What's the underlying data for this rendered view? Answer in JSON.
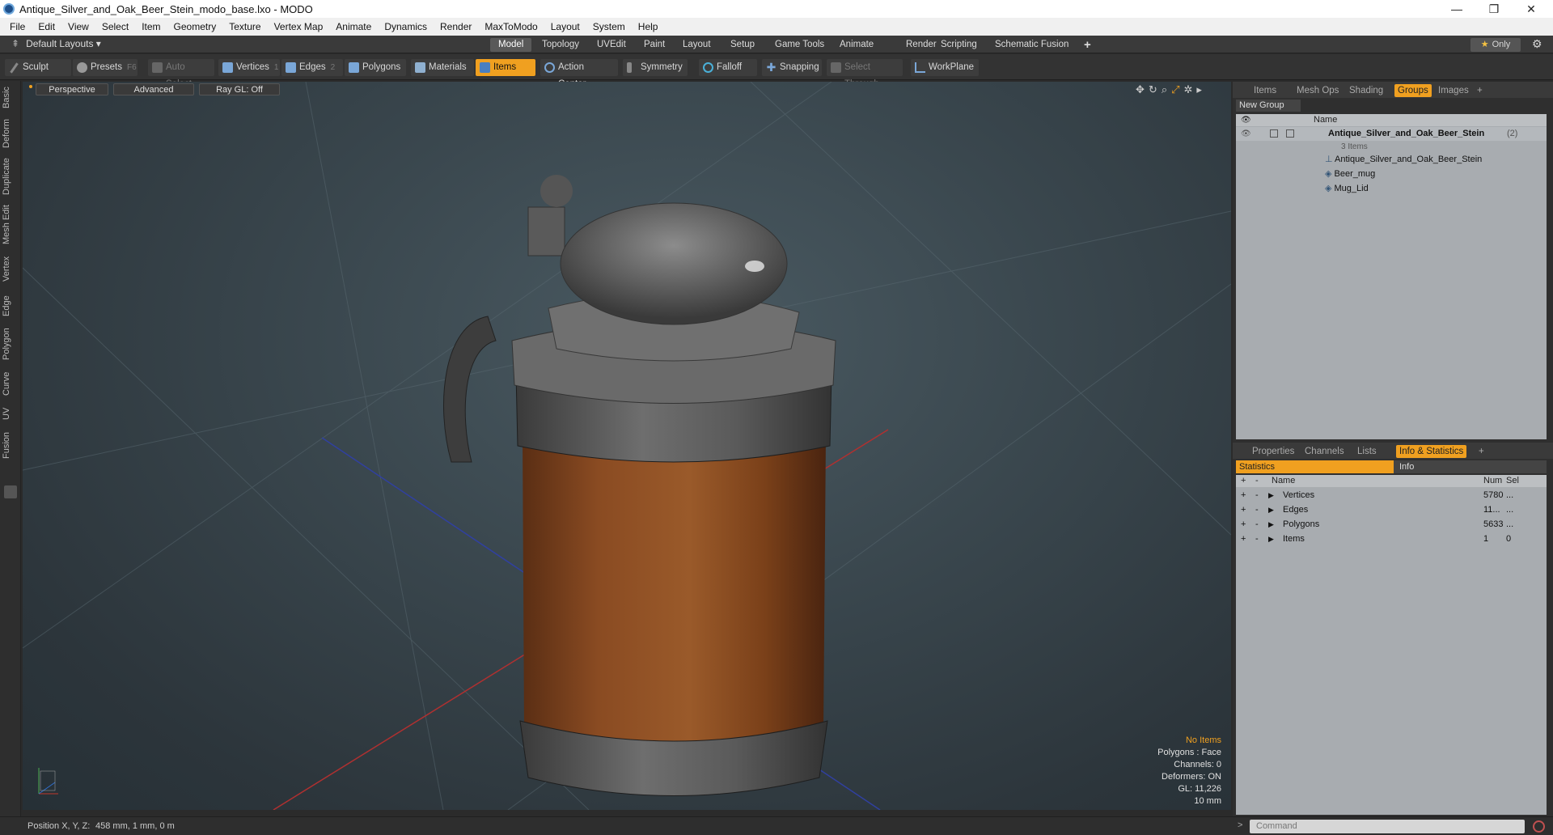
{
  "window": {
    "title": "Antique_Silver_and_Oak_Beer_Stein_modo_base.lxo - MODO",
    "minimize": "—",
    "maximize": "❐",
    "close": "✕"
  },
  "menu": [
    "File",
    "Edit",
    "View",
    "Select",
    "Item",
    "Geometry",
    "Texture",
    "Vertex Map",
    "Animate",
    "Dynamics",
    "Render",
    "MaxToModo",
    "Layout",
    "System",
    "Help"
  ],
  "layoutbar": {
    "layouts_label": "Default Layouts ▾",
    "tabs": [
      "Model",
      "Topology",
      "UVEdit",
      "Paint",
      "Layout",
      "Setup",
      "Game Tools",
      "Animate",
      "Render",
      "Scripting",
      "Schematic Fusion",
      "+"
    ],
    "active_tab": "Model",
    "only_label": "Only",
    "gear": "⚙"
  },
  "toolbar": {
    "sculpt": "Sculpt",
    "presets": "Presets",
    "presets_key": "F6",
    "auto_select": "Auto Select",
    "vertices": "Vertices",
    "vertices_num": "1",
    "edges": "Edges",
    "edges_num": "2",
    "polygons": "Polygons",
    "materials": "Materials",
    "items": "Items",
    "action_center": "Action Center",
    "symmetry": "Symmetry",
    "falloff": "Falloff",
    "snapping": "Snapping",
    "select_through": "Select Through",
    "workplane": "WorkPlane"
  },
  "left_tabs": [
    "Basic",
    "Deform",
    "Duplicate",
    "Mesh Edit",
    "Vertex",
    "Edge",
    "Polygon",
    "Curve",
    "UV",
    "Fusion"
  ],
  "viewport": {
    "perspective": "Perspective",
    "advanced": "Advanced",
    "raygl": "Ray GL: Off",
    "stats": {
      "no_items": "No Items",
      "polygons": "Polygons : Face",
      "channels": "Channels: 0",
      "deformers": "Deformers: ON",
      "gl": "GL: 11,226",
      "scale": "10 mm"
    }
  },
  "groups_panel": {
    "tabs": [
      "Items",
      "Mesh Ops",
      "Shading",
      "Groups",
      "Images",
      "+"
    ],
    "active_tab": "Groups",
    "new_group": "New Group",
    "name_header": "Name",
    "group_name": "Antique_Silver_and_Oak_Beer_Stein",
    "group_count": "(2)",
    "group_items": "3 Items",
    "children": [
      "Antique_Silver_and_Oak_Beer_Stein",
      "Beer_mug",
      "Mug_Lid"
    ]
  },
  "info_panel": {
    "tabs": [
      "Properties",
      "Channels",
      "Lists",
      "Info & Statistics",
      "+"
    ],
    "active_tab": "Info & Statistics",
    "subtabs": [
      "Statistics",
      "Info"
    ],
    "headers": {
      "name": "Name",
      "num": "Num",
      "sel": "Sel"
    },
    "rows": [
      {
        "name": "Vertices",
        "num": "5780",
        "sel": "..."
      },
      {
        "name": "Edges",
        "num": "11...",
        "sel": "..."
      },
      {
        "name": "Polygons",
        "num": "5633",
        "sel": "..."
      },
      {
        "name": "Items",
        "num": "1",
        "sel": "0"
      }
    ]
  },
  "status": {
    "position_label": "Position X, Y, Z:",
    "position_value": "458 mm, 1 mm, 0 m",
    "command_placeholder": "Command"
  }
}
